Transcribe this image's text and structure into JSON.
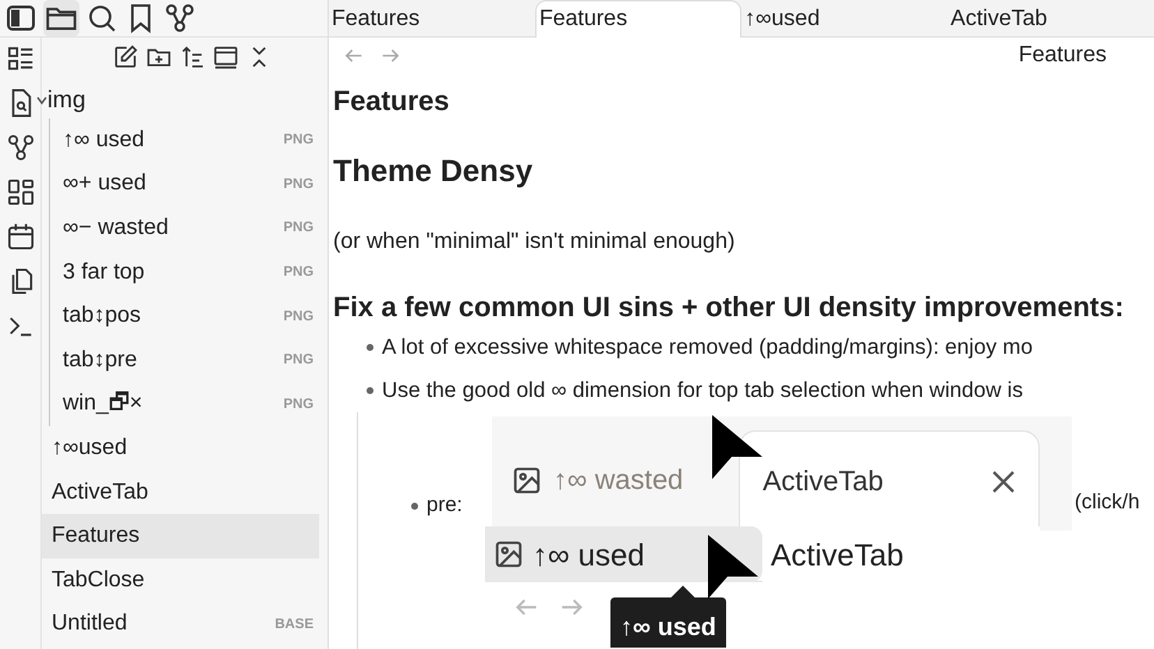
{
  "tabs": [
    {
      "label": "Features",
      "selected": false
    },
    {
      "label": "Features",
      "selected": true
    },
    {
      "label": "↑∞used",
      "selected": false
    },
    {
      "label": "ActiveTab",
      "selected": false
    }
  ],
  "nav": {
    "title": "Features"
  },
  "sidebar": {
    "tree": [
      {
        "label": "img",
        "expanded": true,
        "children": [
          {
            "label": "↑∞ used",
            "badge": "PNG"
          },
          {
            "label": "∞+ used",
            "badge": "PNG"
          },
          {
            "label": "∞− wasted",
            "badge": "PNG"
          },
          {
            "label": "3 far top",
            "badge": "PNG"
          },
          {
            "label": "tab↕pos",
            "badge": "PNG"
          },
          {
            "label": "tab↕pre",
            "badge": "PNG"
          },
          {
            "label": "win_🗗×",
            "badge": "PNG"
          }
        ]
      },
      {
        "label": "↑∞used",
        "selected": false
      },
      {
        "label": "ActiveTab",
        "selected": false
      },
      {
        "label": "Features",
        "selected": true
      },
      {
        "label": "TabClose",
        "selected": false
      },
      {
        "label": "Untitled",
        "badge": "BASE",
        "selected": false
      }
    ]
  },
  "document": {
    "title": "Features",
    "heading": "Theme Densy",
    "paragraph": "(or when \"minimal\" isn't minimal enough)",
    "section_heading": "Fix a few common UI sins + other UI density improvements:",
    "bullets": [
      "A lot of excessive whitespace removed (padding/margins): enjoy mo",
      "Use the good old ∞ dimension for top tab selection when window is"
    ],
    "sub_bullet": {
      "label": "pre:",
      "note": "(click/h"
    },
    "screenshot_1": {
      "tabs": [
        {
          "label": "↑∞ wasted",
          "selected": false
        },
        {
          "label": "ActiveTab",
          "selected": true
        }
      ]
    },
    "screenshot_2": {
      "tabs": [
        {
          "label": "↑∞ used",
          "hovered": true
        },
        {
          "label": "ActiveTab",
          "hovered": false
        }
      ],
      "tooltip": "↑∞ used"
    }
  }
}
